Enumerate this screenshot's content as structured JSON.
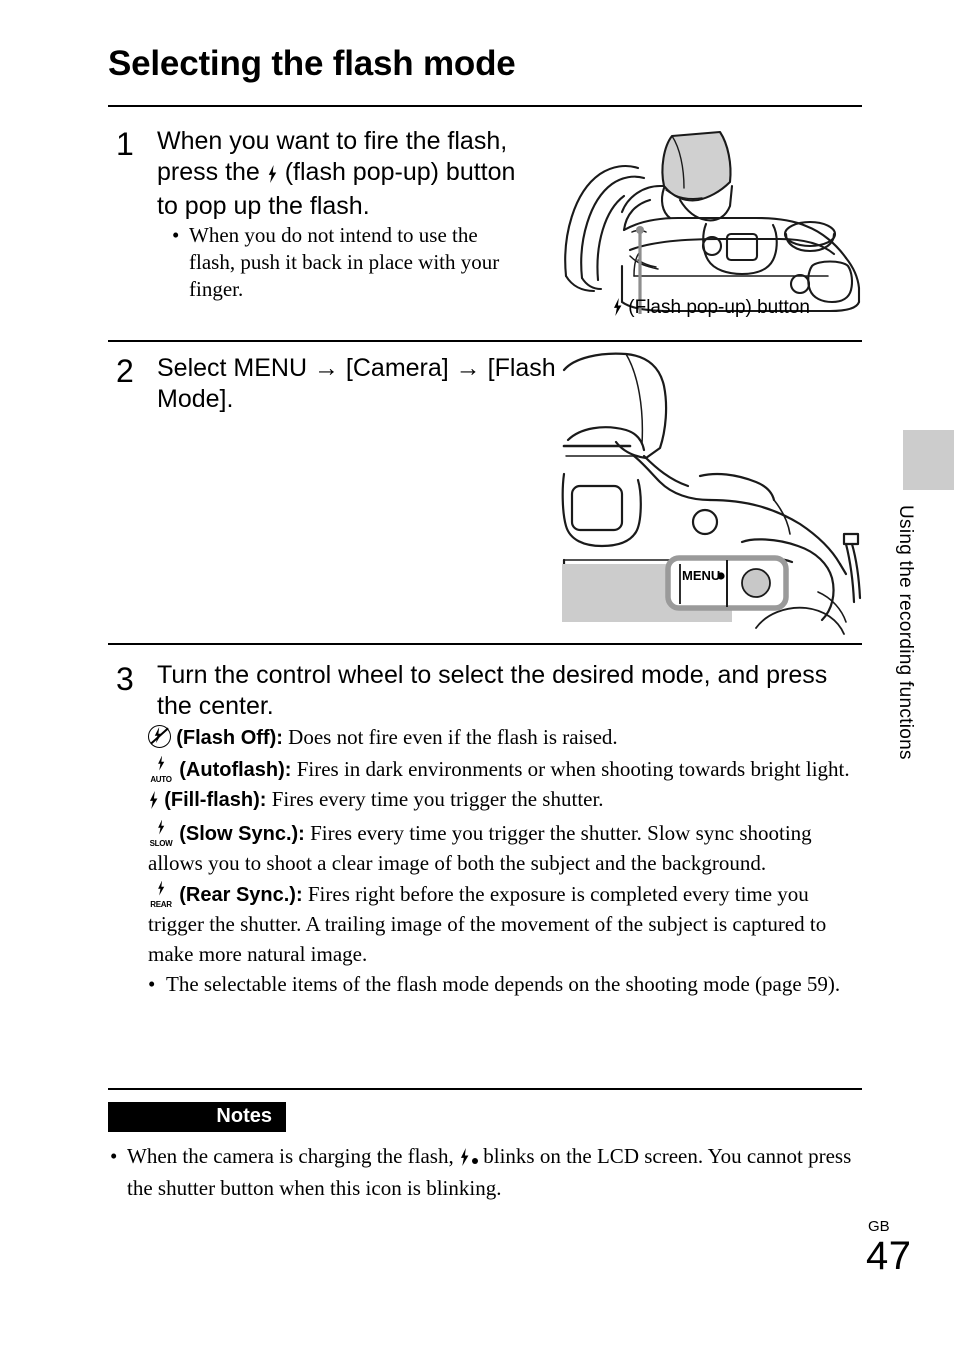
{
  "document": {
    "title": "Selecting the flash mode",
    "page_label": "GB",
    "page_number": "47",
    "side_tab_text": "Using the recording functions"
  },
  "steps": [
    {
      "number": "1",
      "heading_before_icon": "When you want to fire the flash, press the ",
      "icon": "flash-bolt-icon",
      "heading_after_icon": " (flash pop-up) button to pop up the flash.",
      "sub_bullets": [
        "When you do not intend to use the flash, push it back in place with your finger."
      ]
    },
    {
      "number": "2",
      "heading": "Select MENU → [Camera] → [Flash Mode]."
    },
    {
      "number": "3",
      "heading": "Turn the control wheel to select the desired mode, and press the center.",
      "modes": [
        {
          "icon": "flash-off-icon",
          "icon_sub": "",
          "name": "(Flash Off):",
          "description": " Does not fire even if the flash is raised."
        },
        {
          "icon": "flash-auto-icon",
          "icon_sub": "AUTO",
          "name": "(Autoflash):",
          "description": " Fires in dark environments or when shooting towards bright light."
        },
        {
          "icon": "flash-fill-icon",
          "icon_sub": "",
          "name": "(Fill-flash):",
          "description": " Fires every time you trigger the shutter."
        },
        {
          "icon": "flash-slow-sync-icon",
          "icon_sub": "SLOW",
          "name": "(Slow Sync.):",
          "description": " Fires every time you trigger the shutter. Slow sync shooting allows you to shoot a clear image of both the subject and the background."
        },
        {
          "icon": "flash-rear-sync-icon",
          "icon_sub": "REAR",
          "name": "(Rear Sync.):",
          "description": " Fires right before the exposure is completed every time you trigger the shutter. A trailing image of the movement of the subject is captured to make more natural image."
        }
      ],
      "note_bullet": "The selectable items of the flash mode depends on the shooting mode (page 59)."
    }
  ],
  "illustrations": {
    "flash_popup": {
      "caption_text": "(Flash pop-up) button",
      "caption_icon": "flash-bolt-icon",
      "flash_unit_fill": "#d0d0d0",
      "leader_line_color": "#9a9a9a"
    },
    "menu_button": {
      "button_label": "MENU",
      "highlight_fill": "#ffffff",
      "highlight_stroke": "#9a9a9a",
      "lcd_fill": "#cccccc",
      "dial_fill": "#c8c8c8"
    }
  },
  "notes": {
    "label": "Notes",
    "items_before_icon": "When the camera is charging the flash, ",
    "icon": "flash-charging-icon",
    "items_after_icon": " blinks on the LCD screen. You cannot press the shutter button when this icon is blinking."
  },
  "colors": {
    "text": "#000000",
    "side_tab": "#cccccc",
    "notes_bar": "#000000",
    "page_background": "#ffffff"
  }
}
